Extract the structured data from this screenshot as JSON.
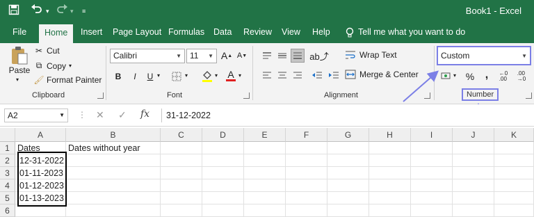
{
  "window": {
    "title": "Book1  -  Excel"
  },
  "quick_access": {
    "save_icon": "save-icon",
    "undo_icon": "undo-icon",
    "redo_icon": "redo-icon",
    "customize_icon": "customize-icon"
  },
  "tabs": [
    {
      "label": "File",
      "active": false
    },
    {
      "label": "Home",
      "active": true
    },
    {
      "label": "Insert",
      "active": false
    },
    {
      "label": "Page Layout",
      "active": false
    },
    {
      "label": "Formulas",
      "active": false
    },
    {
      "label": "Data",
      "active": false
    },
    {
      "label": "Review",
      "active": false
    },
    {
      "label": "View",
      "active": false
    },
    {
      "label": "Help",
      "active": false
    }
  ],
  "tell_me": "Tell me what you want to do",
  "clipboard": {
    "paste": "Paste",
    "cut": "Cut",
    "copy": "Copy",
    "format_painter": "Format Painter",
    "group": "Clipboard"
  },
  "font": {
    "name": "Calibri",
    "size": "11",
    "bold": "B",
    "italic": "I",
    "underline": "U",
    "font_color": "A",
    "grow": "A",
    "shrink": "A",
    "group": "Font"
  },
  "alignment": {
    "wrap": "Wrap Text",
    "merge": "Merge & Center",
    "group": "Alignment"
  },
  "number": {
    "format": "Custom",
    "percent": "%",
    "comma": ",",
    "group": "Number"
  },
  "formula_bar": {
    "name_box": "A2",
    "fx": "fx",
    "cancel": "✕",
    "enter": "✓",
    "value": "31-12-2022"
  },
  "sheet": {
    "columns": [
      "A",
      "B",
      "C",
      "D",
      "E",
      "F",
      "G",
      "H",
      "I",
      "J",
      "K"
    ],
    "rows": [
      "1",
      "2",
      "3",
      "4",
      "5",
      "6"
    ],
    "A1": "Dates",
    "B1": "Dates without year",
    "dates": [
      "12-31-2022",
      "01-11-2023",
      "01-12-2023",
      "01-13-2023"
    ]
  },
  "colors": {
    "excel_green": "#217346",
    "annotation": "#7b7fe6"
  }
}
